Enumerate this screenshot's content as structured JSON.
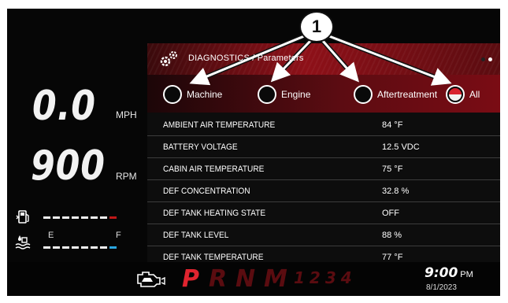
{
  "gauges": {
    "speed_value": "0.0",
    "speed_unit": "MPH",
    "rpm_value": "900",
    "rpm_unit": "RPM",
    "fuel_icon": "fuel-pump-icon",
    "def_icon": "def-fluid-icon",
    "fuel_level_fraction": 0.875,
    "def_level_fraction": 0.875,
    "def_empty_label": "E",
    "def_full_label": "F",
    "fuel_low_color": "#c01818",
    "def_full_color": "#2aa6e0"
  },
  "panel": {
    "icon": "gears-icon",
    "title": "DIAGNOSTICS / Parameters",
    "tabs": [
      {
        "label": "Machine",
        "selected": false
      },
      {
        "label": "Engine",
        "selected": false
      },
      {
        "label": "Aftertreatment",
        "selected": false
      },
      {
        "label": "All",
        "selected": true
      }
    ],
    "parameters": [
      {
        "name": "AMBIENT AIR TEMPERATURE",
        "value": "84 °F"
      },
      {
        "name": "BATTERY VOLTAGE",
        "value": "12.5 VDC"
      },
      {
        "name": "CABIN AIR TEMPERATURE",
        "value": "75 °F"
      },
      {
        "name": "DEF CONCENTRATION",
        "value": "32.8 %"
      },
      {
        "name": "DEF TANK HEATING STATE",
        "value": "OFF"
      },
      {
        "name": "DEF TANK LEVEL",
        "value": "88 %"
      },
      {
        "name": "DEF TANK TEMPERATURE",
        "value": "77 °F"
      }
    ]
  },
  "callout": {
    "number": "1"
  },
  "bottom": {
    "engine_icon": "check-engine-icon",
    "gears": [
      {
        "label": "P",
        "active": true
      },
      {
        "label": "R",
        "active": false
      },
      {
        "label": "N",
        "active": false
      },
      {
        "label": "M",
        "active": false
      }
    ],
    "gear_numbers": "1234",
    "time": "9:00",
    "ampm": "PM",
    "date": "8/1/2023"
  },
  "colors": {
    "accent_red": "#e0242f",
    "header_red": "#8e1018"
  }
}
